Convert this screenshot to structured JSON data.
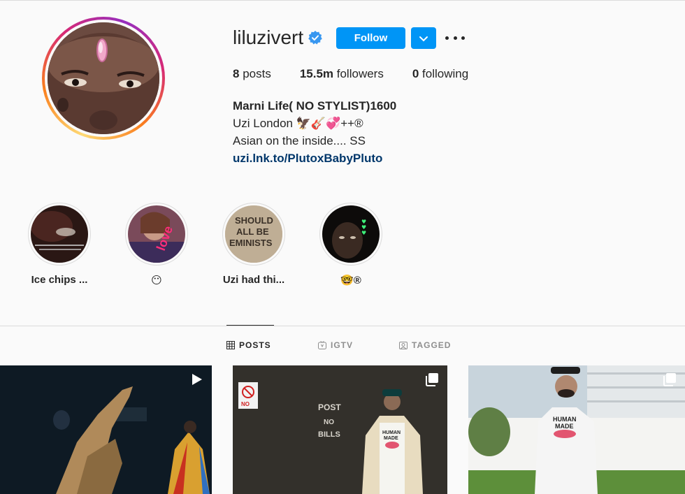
{
  "profile": {
    "username": "liluzivert",
    "follow_label": "Follow",
    "stats": {
      "posts_count": "8",
      "posts_label": " posts",
      "followers_count": "15.5m",
      "followers_label": " followers",
      "following_count": "0",
      "following_label": " following"
    },
    "bio": {
      "name": "Marni Life( NO STYLIST)1600",
      "line1": "Uzi London 🦅🎸💞++®",
      "line2": "Asian on the inside.... SS",
      "link": "uzi.lnk.to/PlutoxBabyPluto"
    }
  },
  "highlights": [
    {
      "label": "Ice chips ..."
    },
    {
      "label": "😶"
    },
    {
      "label": "Uzi had thi..."
    },
    {
      "label": "🤓®"
    }
  ],
  "tabs": [
    {
      "label": "POSTS",
      "icon": "grid-icon",
      "active": true
    },
    {
      "label": "IGTV",
      "icon": "igtv-icon",
      "active": false
    },
    {
      "label": "TAGGED",
      "icon": "tagged-icon",
      "active": false
    }
  ],
  "colors": {
    "accent": "#0095f6",
    "link": "#00376b",
    "text": "#262626",
    "muted": "#8e8e8e",
    "background": "#fafafa",
    "border": "#dbdbdb"
  },
  "icons": {
    "verified": "verified-badge-icon",
    "dropdown": "chevron-down-icon",
    "more": "more-options-icon",
    "video": "play-icon",
    "multiple": "carousel-icon"
  }
}
